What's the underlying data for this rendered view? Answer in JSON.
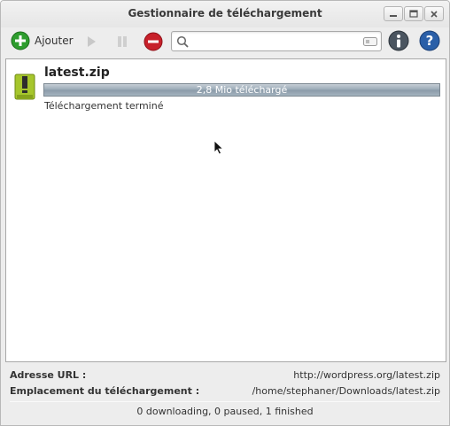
{
  "window": {
    "title": "Gestionnaire de téléchargement"
  },
  "toolbar": {
    "add_label": "Ajouter",
    "search_placeholder": "",
    "search_value": ""
  },
  "downloads": [
    {
      "filename": "latest.zip",
      "progress_text": "2,8 Mio téléchargé",
      "progress": 1.0,
      "status": "Téléchargement terminé",
      "icon": "zip-archive-icon"
    }
  ],
  "details": {
    "url_label": "Adresse URL :",
    "url_value": "http://wordpress.org/latest.zip",
    "location_label": "Emplacement du téléchargement :",
    "location_value": "/home/stephaner/Downloads/latest.zip"
  },
  "statusbar": {
    "text": "0 downloading, 0 paused, 1 finished"
  },
  "colors": {
    "add_green": "#2e9d2e",
    "stop_red": "#c7202a",
    "info_blue": "#2a5fa8",
    "progress": "#98a8b5"
  }
}
